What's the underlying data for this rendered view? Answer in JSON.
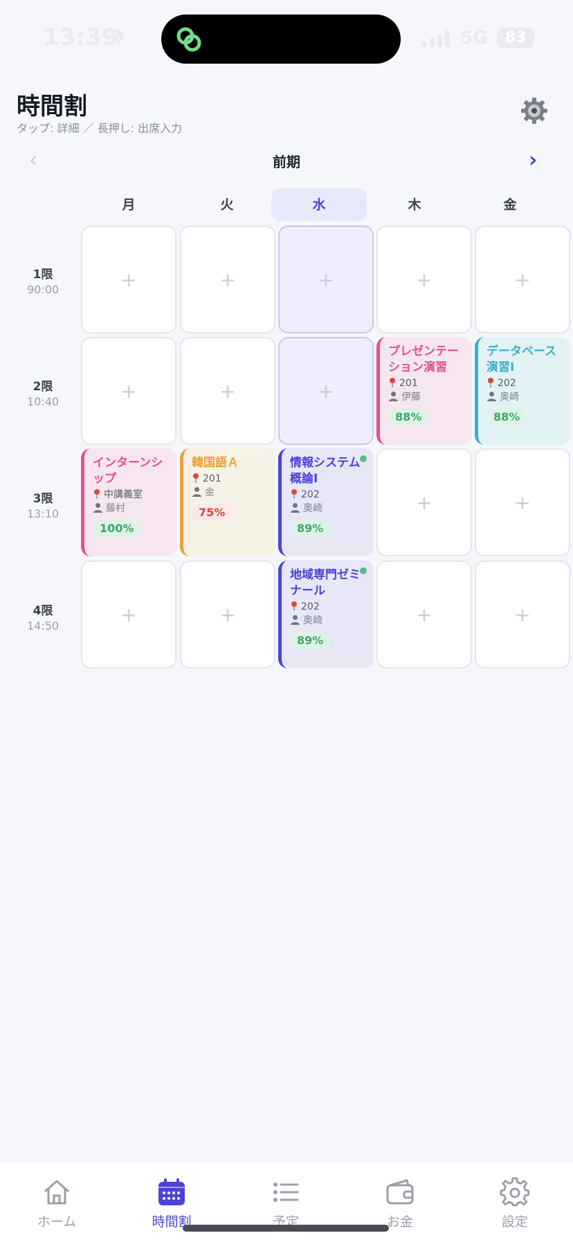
{
  "status_bar": {
    "time": "13:39",
    "network": "5G",
    "battery": "83"
  },
  "header": {
    "title": "時間割",
    "hint": "タップ: 詳細 ／ 長押し: 出席入力"
  },
  "term": {
    "prev": "‹",
    "label": "前期",
    "next": "›"
  },
  "days": [
    {
      "label": "月",
      "today": false
    },
    {
      "label": "火",
      "today": false
    },
    {
      "label": "水",
      "today": true
    },
    {
      "label": "木",
      "today": false
    },
    {
      "label": "金",
      "today": false
    }
  ],
  "periods": [
    {
      "name": "1限",
      "time": "90:00"
    },
    {
      "name": "2限",
      "time": "10:40"
    },
    {
      "name": "3限",
      "time": "13:10"
    },
    {
      "name": "4限",
      "time": "14:50"
    }
  ],
  "empty_symbol": "+",
  "courses": {
    "p2_thu": {
      "name": "プレゼンテーション演習",
      "room": "201",
      "teacher": "伊藤",
      "attendance": "88%",
      "color": "#e0508f",
      "bg": "#f6e6ef"
    },
    "p2_fri": {
      "name": "データベース演習Ⅰ",
      "room": "202",
      "teacher": "奥崎",
      "attendance": "88%",
      "color": "#3db1cc",
      "bg": "#e3f2f5"
    },
    "p3_mon": {
      "name": "インターンシップ",
      "room": "中講義室",
      "teacher": "藤村",
      "attendance": "100%",
      "color": "#e0508f",
      "bg": "#f6e6ef"
    },
    "p3_tue": {
      "name": "韓国語Ａ",
      "room": "201",
      "teacher": "金",
      "attendance": "75%",
      "color": "#eba03c",
      "bg": "#f7f2e6"
    },
    "p3_wed": {
      "name": "情報システム概論Ⅰ",
      "room": "202",
      "teacher": "奥崎",
      "attendance": "89%",
      "color": "#4b43d6",
      "bg": "#e8e7f6"
    },
    "p4_wed": {
      "name": "地域専門ゼミナール",
      "room": "202",
      "teacher": "奥崎",
      "attendance": "89%",
      "color": "#4b43d6",
      "bg": "#e8e7f6"
    }
  },
  "tabs": [
    {
      "label": "ホーム",
      "icon": "home-icon",
      "active": false
    },
    {
      "label": "時間割",
      "icon": "calendar-icon",
      "active": true
    },
    {
      "label": "予定",
      "icon": "list-icon",
      "active": false
    },
    {
      "label": "お金",
      "icon": "wallet-icon",
      "active": false
    },
    {
      "label": "設定",
      "icon": "gear-icon",
      "active": false
    }
  ],
  "colors": {
    "accent": "#4b43d6",
    "good": "#3ea668",
    "bad": "#d9463f"
  }
}
